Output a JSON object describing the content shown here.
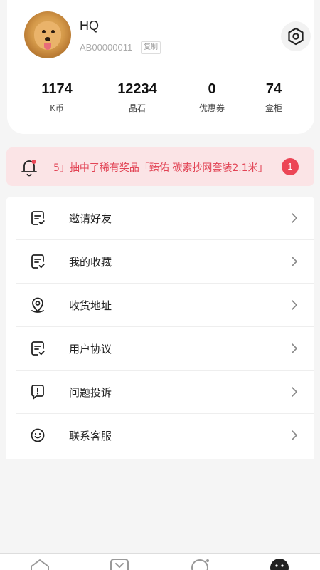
{
  "profile": {
    "username": "HQ",
    "user_id": "AB00000011",
    "copy_label": "复制",
    "stats": [
      {
        "value": "1174",
        "label": "K币"
      },
      {
        "value": "12234",
        "label": "晶石"
      },
      {
        "value": "0",
        "label": "优惠券"
      },
      {
        "value": "74",
        "label": "盒柜"
      }
    ]
  },
  "notice": {
    "text": "5」抽中了稀有奖品「臻佑 碳素抄网套装2.1米」",
    "badge": "1"
  },
  "menu": {
    "items": [
      {
        "label": "邀请好友",
        "icon": "note-check-icon"
      },
      {
        "label": "我的收藏",
        "icon": "note-check-icon"
      },
      {
        "label": "收货地址",
        "icon": "location-pin-icon"
      },
      {
        "label": "用户协议",
        "icon": "note-check-icon"
      },
      {
        "label": "问题投诉",
        "icon": "alert-message-icon"
      },
      {
        "label": "联系客服",
        "icon": "smile-icon"
      }
    ]
  },
  "tabbar": {
    "tabs": [
      {
        "icon": "home-icon"
      },
      {
        "icon": "box-icon"
      },
      {
        "icon": "planet-icon"
      },
      {
        "icon": "profile-icon"
      }
    ]
  },
  "colors": {
    "accent": "#ec4656",
    "notice_bg": "#fbe4e6",
    "notice_text": "#e24455"
  }
}
